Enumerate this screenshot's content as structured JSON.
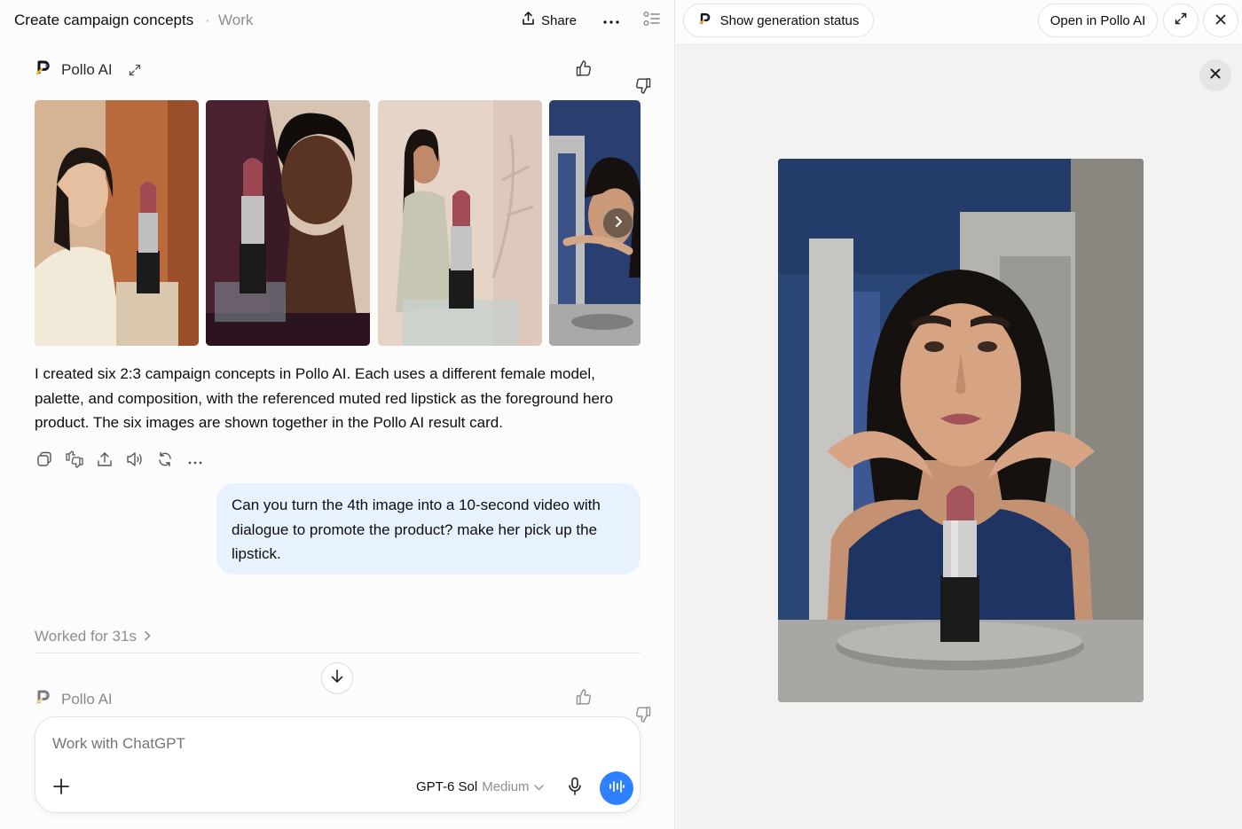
{
  "header": {
    "title": "Create campaign concepts",
    "separator": "·",
    "project": "Work",
    "share_label": "Share"
  },
  "message": {
    "app_name": "Pollo AI",
    "reply_text": "I created six 2:3 campaign concepts in Pollo AI. Each uses a different female model, palette, and composition, with the referenced muted red lipstick as the foreground hero product. The six images are shown together in the Pollo AI result card."
  },
  "gallery": {
    "images": [
      "image-1",
      "image-2",
      "image-3",
      "image-4"
    ]
  },
  "user_message": {
    "text": "Can you turn the 4th image into a 10-second video with dialogue to promote the product? make her pick up the lipstick."
  },
  "status": {
    "worked_label": "Worked for 31s"
  },
  "next_message": {
    "app_name": "Pollo AI"
  },
  "composer": {
    "placeholder": "Work with ChatGPT",
    "model_name": "GPT-6 Sol",
    "model_effort": "Medium"
  },
  "right_panel": {
    "status_label": "Show generation status",
    "open_label": "Open in Pollo AI"
  },
  "colors": {
    "accent": "#2f80ff",
    "user_bubble": "#e8f2ff"
  }
}
